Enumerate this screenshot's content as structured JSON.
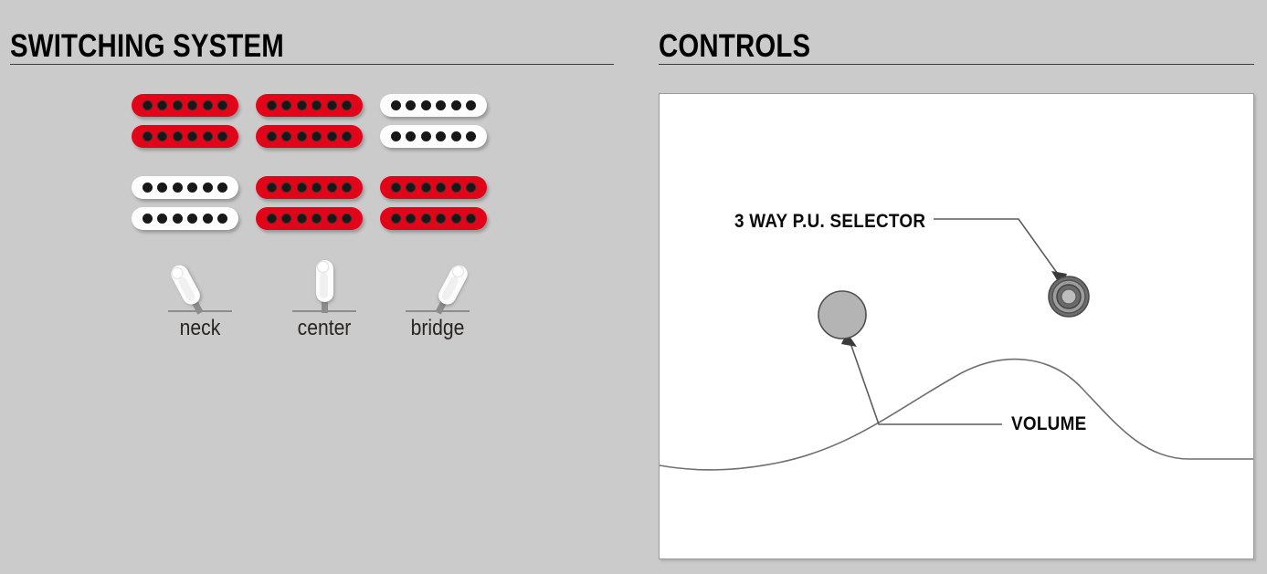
{
  "background_color": "#cbcbcb",
  "accent_red": "#e2051a",
  "switching": {
    "title": "SWITCHING SYSTEM",
    "pickup_grid": {
      "columns": 3,
      "rows": 2,
      "cells": [
        {
          "position": "neck",
          "row": 1,
          "col": 1,
          "color": "red",
          "state": "active",
          "coils": 2,
          "poles_per_coil": 6
        },
        {
          "position": "center",
          "row": 1,
          "col": 2,
          "color": "red",
          "state": "active",
          "coils": 2,
          "poles_per_coil": 6
        },
        {
          "position": "bridge",
          "row": 1,
          "col": 3,
          "color": "white",
          "state": "inactive",
          "coils": 2,
          "poles_per_coil": 6
        },
        {
          "position": "neck",
          "row": 2,
          "col": 1,
          "color": "white",
          "state": "inactive",
          "coils": 2,
          "poles_per_coil": 6
        },
        {
          "position": "center",
          "row": 2,
          "col": 2,
          "color": "red",
          "state": "active",
          "coils": 2,
          "poles_per_coil": 6
        },
        {
          "position": "bridge",
          "row": 2,
          "col": 3,
          "color": "red",
          "state": "active",
          "coils": 2,
          "poles_per_coil": 6
        }
      ]
    },
    "switch_positions": [
      {
        "label": "neck",
        "lever_angle": -28
      },
      {
        "label": "center",
        "lever_angle": 0
      },
      {
        "label": "bridge",
        "lever_angle": 28
      }
    ]
  },
  "controls": {
    "title": "CONTROLS",
    "callouts": [
      {
        "label": "3 WAY P.U. SELECTOR",
        "target": "pickup-selector-switch"
      },
      {
        "label": "VOLUME",
        "target": "volume-knob"
      }
    ]
  }
}
